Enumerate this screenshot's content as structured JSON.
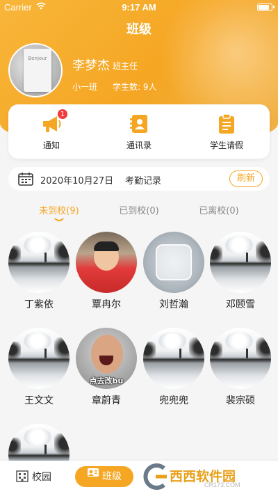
{
  "status_bar": {
    "carrier": "Carrier",
    "time": "9:17 AM",
    "battery_level": 0.9
  },
  "header": {
    "title": "班级"
  },
  "profile": {
    "avatar_card_text": "Bonjour",
    "name": "李梦杰",
    "role": "班主任",
    "class_name": "小一班",
    "student_count": "学生数: 9人"
  },
  "shortcuts": [
    {
      "label": "通知",
      "icon": "megaphone-icon",
      "badge": "1"
    },
    {
      "label": "通讯录",
      "icon": "contacts-book-icon"
    },
    {
      "label": "学生请假",
      "icon": "clipboard-icon"
    }
  ],
  "attendance": {
    "date": "2020年10月27日",
    "record_label": "考勤记录",
    "refresh_label": "刷新"
  },
  "tabs": [
    {
      "label": "未到校(9)",
      "active": true
    },
    {
      "label": "已到校(0)",
      "active": false
    },
    {
      "label": "已离校(0)",
      "active": false
    }
  ],
  "students": [
    {
      "name": "丁紫依",
      "avatar": "landscape"
    },
    {
      "name": "覃冉尔",
      "avatar": "boy-photo"
    },
    {
      "name": "刘哲瀚",
      "avatar": "cup-photo"
    },
    {
      "name": "邓颐雪",
      "avatar": "landscape"
    },
    {
      "name": "王文文",
      "avatar": "landscape"
    },
    {
      "name": "章蔚青",
      "avatar": "man-photo",
      "caption": "点去改bu"
    },
    {
      "name": "兜兜兜",
      "avatar": "landscape"
    },
    {
      "name": "裴宗硕",
      "avatar": "landscape"
    },
    {
      "name": "",
      "avatar": "landscape"
    }
  ],
  "bottom_nav": {
    "school_label": "校园",
    "class_label": "班级"
  },
  "watermark": {
    "main": "西西软件园",
    "sub": "CR173.COM"
  },
  "colors": {
    "accent": "#f5a623",
    "badge": "#f23a3a"
  }
}
